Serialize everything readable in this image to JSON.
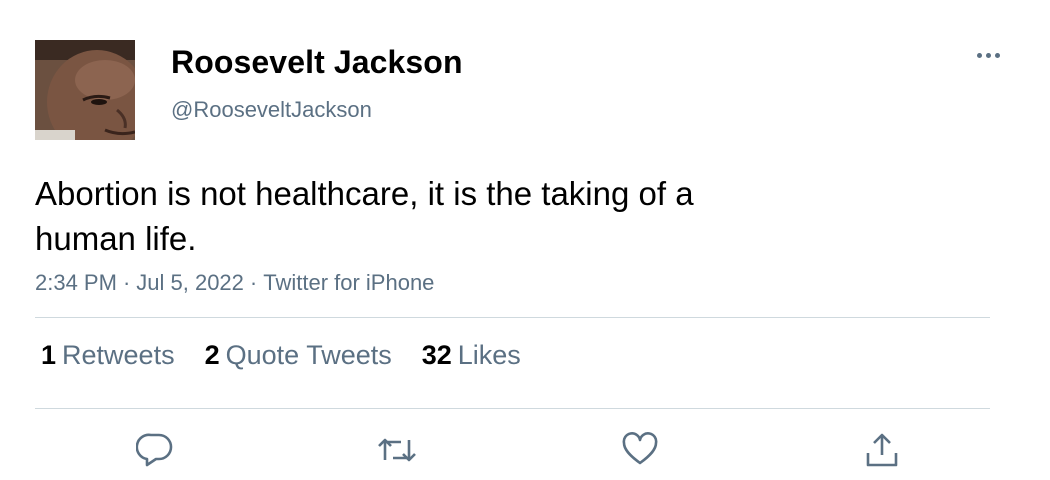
{
  "author": {
    "display_name": "Roosevelt Jackson",
    "handle": "@RooseveltJackson"
  },
  "tweet": {
    "text": "Abortion is not healthcare, it is the taking of a human life.",
    "time": "2:34 PM",
    "date": "Jul 5, 2022",
    "source": "Twitter for iPhone",
    "separator": "·"
  },
  "stats": {
    "retweets_count": "1",
    "retweets_label": "Retweets",
    "quotes_count": "2",
    "quotes_label": "Quote Tweets",
    "likes_count": "32",
    "likes_label": "Likes"
  },
  "icons": {
    "more": "more-horizontal-icon",
    "reply": "reply-icon",
    "retweet": "retweet-icon",
    "like": "heart-icon",
    "share": "share-icon"
  },
  "colors": {
    "secondary_text": "#5b7083",
    "divider": "#cfd9de",
    "primary_text": "#000000"
  }
}
